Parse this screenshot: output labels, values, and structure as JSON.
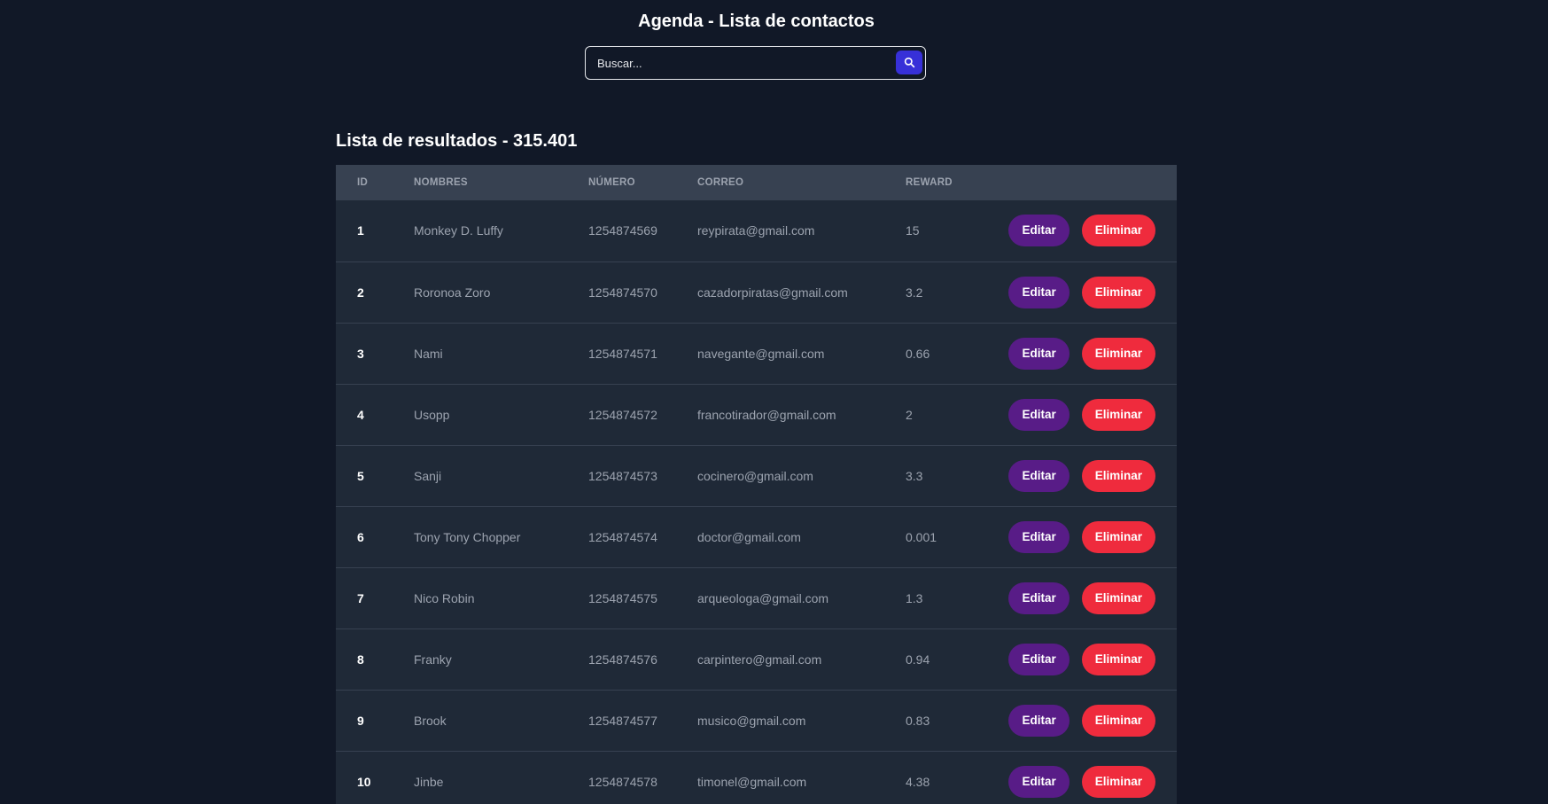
{
  "header": {
    "title": "Agenda - Lista de contactos"
  },
  "search": {
    "placeholder": "Buscar...",
    "value": "",
    "button_icon": "search-icon",
    "button_color": "#3730d8"
  },
  "results": {
    "title": "Lista de resultados - 315.401"
  },
  "table": {
    "columns": [
      "ID",
      "NOMBRES",
      "NÚMERO",
      "CORREO",
      "REWARD",
      ""
    ],
    "rows": [
      {
        "id": "1",
        "name": "Monkey D. Luffy",
        "number": "1254874569",
        "email": "reypirata@gmail.com",
        "reward": "15"
      },
      {
        "id": "2",
        "name": "Roronoa Zoro",
        "number": "1254874570",
        "email": "cazadorpiratas@gmail.com",
        "reward": "3.2"
      },
      {
        "id": "3",
        "name": "Nami",
        "number": "1254874571",
        "email": "navegante@gmail.com",
        "reward": "0.66"
      },
      {
        "id": "4",
        "name": "Usopp",
        "number": "1254874572",
        "email": "francotirador@gmail.com",
        "reward": "2"
      },
      {
        "id": "5",
        "name": "Sanji",
        "number": "1254874573",
        "email": "cocinero@gmail.com",
        "reward": "3.3"
      },
      {
        "id": "6",
        "name": "Tony Tony Chopper",
        "number": "1254874574",
        "email": "doctor@gmail.com",
        "reward": "0.001"
      },
      {
        "id": "7",
        "name": "Nico Robin",
        "number": "1254874575",
        "email": "arqueologa@gmail.com",
        "reward": "1.3"
      },
      {
        "id": "8",
        "name": "Franky",
        "number": "1254874576",
        "email": "carpintero@gmail.com",
        "reward": "0.94"
      },
      {
        "id": "9",
        "name": "Brook",
        "number": "1254874577",
        "email": "musico@gmail.com",
        "reward": "0.83"
      },
      {
        "id": "10",
        "name": "Jinbe",
        "number": "1254874578",
        "email": "timonel@gmail.com",
        "reward": "4.38"
      }
    ],
    "actions": {
      "edit_label": "Editar",
      "delete_label": "Eliminar"
    }
  },
  "colors": {
    "background": "#111827",
    "table_header": "#374151",
    "row": "#1f2937",
    "edit_button": "#581c87",
    "delete_button": "#ef2b3d"
  }
}
